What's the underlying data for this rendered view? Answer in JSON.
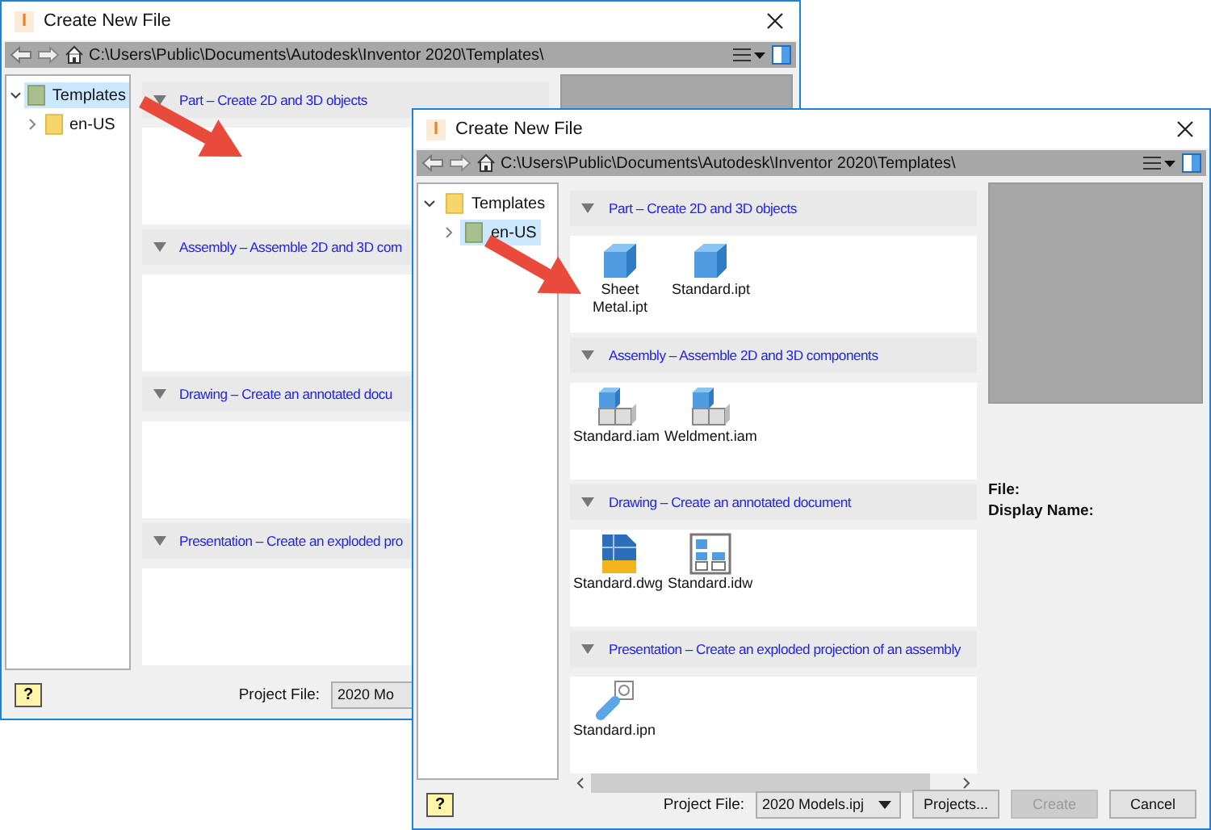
{
  "windows": [
    {
      "title": "Create New File",
      "app_icon": "I",
      "path": "C:\\Users\\Public\\Documents\\Autodesk\\Inventor 2020\\Templates\\",
      "tree": [
        {
          "label": "Templates",
          "expanded": true,
          "selected": true,
          "children": [
            {
              "label": "en-US",
              "expanded": false,
              "selected": false
            }
          ]
        }
      ],
      "sections": [
        {
          "title": "Part – Create 2D and 3D objects",
          "expanded": true
        },
        {
          "title": "Assembly – Assemble 2D and 3D com",
          "expanded": true
        },
        {
          "title": "Drawing – Create an annotated docu",
          "expanded": true
        },
        {
          "title": "Presentation – Create an exploded pro",
          "expanded": true
        }
      ],
      "footer": {
        "help": "?",
        "project_label": "Project File:",
        "project_value": "2020 Mo"
      }
    },
    {
      "title": "Create New File",
      "app_icon": "I",
      "path": "C:\\Users\\Public\\Documents\\Autodesk\\Inventor 2020\\Templates\\",
      "tree": [
        {
          "label": "Templates",
          "expanded": true,
          "selected": false,
          "children": [
            {
              "label": "en-US",
              "expanded": false,
              "selected": true
            }
          ]
        }
      ],
      "sections": [
        {
          "title": "Part – Create 2D and 3D objects",
          "expanded": true,
          "items": [
            {
              "name": "Sheet Metal.ipt",
              "kind": "part"
            },
            {
              "name": "Standard.ipt",
              "kind": "part"
            }
          ]
        },
        {
          "title": "Assembly – Assemble 2D and 3D components",
          "expanded": true,
          "items": [
            {
              "name": "Standard.iam",
              "kind": "assembly"
            },
            {
              "name": "Weldment.iam",
              "kind": "assembly"
            }
          ]
        },
        {
          "title": "Drawing – Create an annotated document",
          "expanded": true,
          "items": [
            {
              "name": "Standard.dwg",
              "kind": "dwg"
            },
            {
              "name": "Standard.idw",
              "kind": "idw"
            }
          ]
        },
        {
          "title": "Presentation – Create an exploded projection of an assembly",
          "expanded": true,
          "items": [
            {
              "name": "Standard.ipn",
              "kind": "presentation"
            }
          ]
        }
      ],
      "details": [
        "File:",
        "Display Name:"
      ],
      "footer": {
        "help": "?",
        "project_label": "Project File:",
        "project_value": "2020 Models.ipj",
        "buttons": [
          {
            "label": "Projects...",
            "disabled": false
          },
          {
            "label": "Create",
            "disabled": true
          },
          {
            "label": "Cancel",
            "disabled": false
          }
        ]
      }
    }
  ]
}
